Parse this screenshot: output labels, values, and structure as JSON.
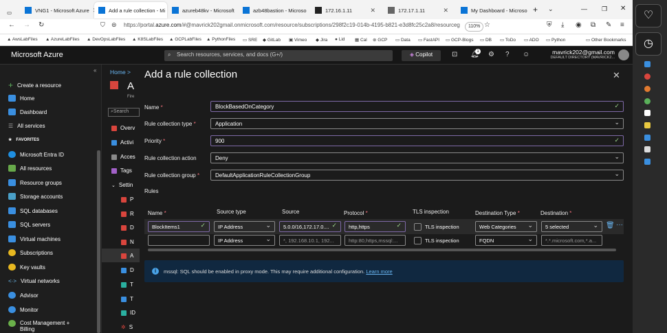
{
  "browser": {
    "tabs": [
      {
        "label": "VNG1 - Microsoft Azure",
        "active": false
      },
      {
        "label": "Add a rule collection - Mi",
        "active": true
      },
      {
        "label": "azureb48kv - Microsoft",
        "active": false
      },
      {
        "label": "azb48bastion - Microso",
        "active": false
      },
      {
        "label": "172.16.1.11",
        "active": false
      },
      {
        "label": "172.17.1.11",
        "active": false
      },
      {
        "label": "My Dashboard - Microso",
        "active": false
      }
    ],
    "url_prefix": "https://portal.",
    "url_host": "azure.com",
    "url_rest": "/#@mavrick202gmail.onmicrosoft.com/resource/subscriptions/298f2c19-014b-4195-b821-e3d8fc25c2a8/resourceg",
    "zoom": "110%",
    "bookmarks": [
      "AwsLabFiles",
      "AzureLabFiles",
      "DevOpsLabFiles",
      "K8SLabFiles",
      "GCPLabFiles",
      "PythonFiles",
      "SRE",
      "GitLab",
      "Vimeo",
      "Jira",
      "Lid",
      "Cal",
      "GCP",
      "Data",
      "FastAPI",
      "GCP-Blogs",
      "DB",
      "ToDo",
      "ADO",
      "Python",
      "Other Bookmarks"
    ]
  },
  "portal": {
    "brand": "Microsoft Azure",
    "search_placeholder": "Search resources, services, and docs (G+/)",
    "copilot": "Copilot",
    "notif_count": "1",
    "account_email": "mavrick202@gmail.com",
    "account_dir": "DEFAULT DIRECTORY (MAVRICK2..."
  },
  "nav": {
    "create": "Create a resource",
    "home": "Home",
    "dashboard": "Dashboard",
    "all_services": "All services",
    "favorites": "FAVORITES",
    "items": [
      "Microsoft Entra ID",
      "All resources",
      "Resource groups",
      "Storage accounts",
      "SQL databases",
      "SQL servers",
      "Virtual machines",
      "Subscriptions",
      "Key vaults",
      "Virtual networks",
      "Advisor",
      "Monitor",
      "Cost Management + Billing"
    ]
  },
  "blade": {
    "breadcrumb": "Home >",
    "title_letter": "A",
    "subtitle": "Fire",
    "search": "Search",
    "items": [
      "Overv",
      "Activi",
      "Acces",
      "Tags",
      "Settin",
      "P",
      "R",
      "D",
      "N",
      "A",
      "D",
      "T",
      "T",
      "ID",
      "S"
    ]
  },
  "panel": {
    "title": "Add a rule collection",
    "fields": {
      "name_label": "Name",
      "name_value": "BlockBasedOnCategory",
      "type_label": "Rule collection type",
      "type_value": "Application",
      "priority_label": "Priority",
      "priority_value": "900",
      "action_label": "Rule collection action",
      "action_value": "Deny",
      "group_label": "Rule collection group",
      "group_value": "DefaultApplicationRuleCollectionGroup",
      "rules_label": "Rules"
    },
    "columns": {
      "name": "Name",
      "source_type": "Source type",
      "source": "Source",
      "protocol": "Protocol",
      "tls": "TLS inspection",
      "dest_type": "Destination Type",
      "destination": "Destination"
    },
    "rows": [
      {
        "name": "BlockItems1",
        "source_type": "IP Address",
        "source": "5.0.0/16,172.17.0....",
        "protocol": "http,https",
        "tls": "TLS inspection",
        "dest_type": "Web Categories",
        "destination": "5 selected"
      },
      {
        "name": "",
        "source_type": "IP Address",
        "source": "*, 192.168.10.1, 192...",
        "protocol": "http:80,https,mssql:...",
        "tls": "TLS inspection",
        "dest_type": "FQDN",
        "destination": "*.*.microsoft.com,*.a..."
      }
    ],
    "info_text": "mssql: SQL should be enabled in proxy mode. This may require additional configuration.",
    "info_link": "Learn more"
  }
}
